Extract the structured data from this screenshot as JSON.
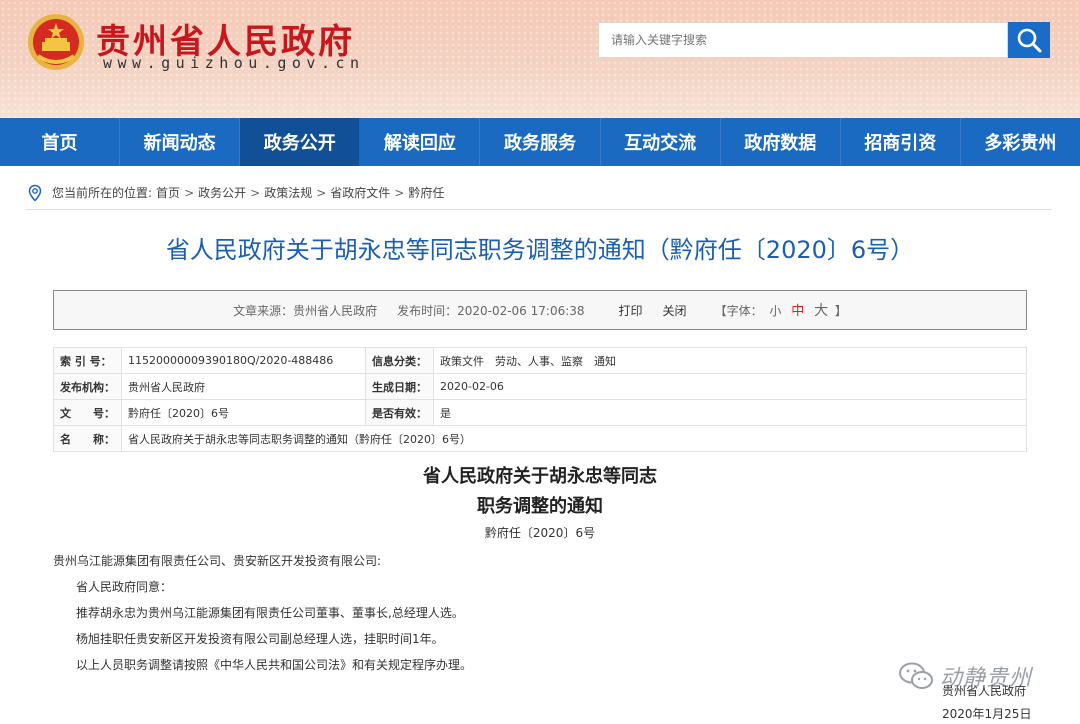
{
  "header": {
    "site_title": "贵州省人民政府",
    "site_url": "www.guizhou.gov.cn",
    "search_placeholder": "请输入关键字搜索",
    "accent": "#c8161d"
  },
  "nav": {
    "items": [
      "首页",
      "新闻动态",
      "政务公开",
      "解读回应",
      "政务服务",
      "互动交流",
      "政府数据",
      "招商引资",
      "多彩贵州"
    ],
    "active": "政务公开",
    "color": "#1a6ac1"
  },
  "breadcrumb": {
    "prefix": "您当前所在的位置:",
    "items": [
      "首页",
      "政务公开",
      "政策法规",
      "省政府文件",
      "黔府任"
    ]
  },
  "doc": {
    "title": "省人民政府关于胡永忠等同志职务调整的通知（黔府任〔2020〕6号）",
    "source": "文章来源：贵州省人民政府",
    "publish_time": "发布时间：2020-02-06 17:06:38",
    "print_label": "打印",
    "close_label": "关闭",
    "font_label": "【字体：",
    "font_small": "小",
    "font_mid": "中",
    "font_big": "大",
    "font_end": "】"
  },
  "info": {
    "index_label": "索 引 号：",
    "index_value": "11520000009390180Q/2020-488486",
    "category_label": "信息分类：",
    "category_value": "政策文件　劳动、人事、监察　通知",
    "issuer_label": "发布机构：",
    "issuer_value": "贵州省人民政府",
    "date_label": "生成日期：",
    "date_value": "2020-02-06",
    "docno_label": "文　　号：",
    "docno_value": "黔府任〔2020〕6号",
    "valid_label": "是否有效：",
    "valid_value": "是",
    "name_label": "名　　称：",
    "name_value": "省人民政府关于胡永忠等同志职务调整的通知（黔府任〔2020〕6号）"
  },
  "body": {
    "title_line1": "省人民政府关于胡永忠等同志",
    "title_line2": "职务调整的通知",
    "doc_no": "黔府任〔2020〕6号",
    "addressee": "贵州乌江能源集团有限责任公司、贵安新区开发投资有限公司:",
    "p1": "省人民政府同意：",
    "p2": "推荐胡永忠为贵州乌江能源集团有限责任公司董事、董事长,总经理人选。",
    "p3": "杨旭挂职任贵安新区开发投资有限公司副总经理人选，挂职时间1年。",
    "p4": "以上人员职务调整请按照《中华人民共和国公司法》和有关规定程序办理。",
    "sign_org": "贵州省人民政府",
    "sign_date": "2020年1月25日"
  },
  "watermark": {
    "text": "动静贵州"
  }
}
